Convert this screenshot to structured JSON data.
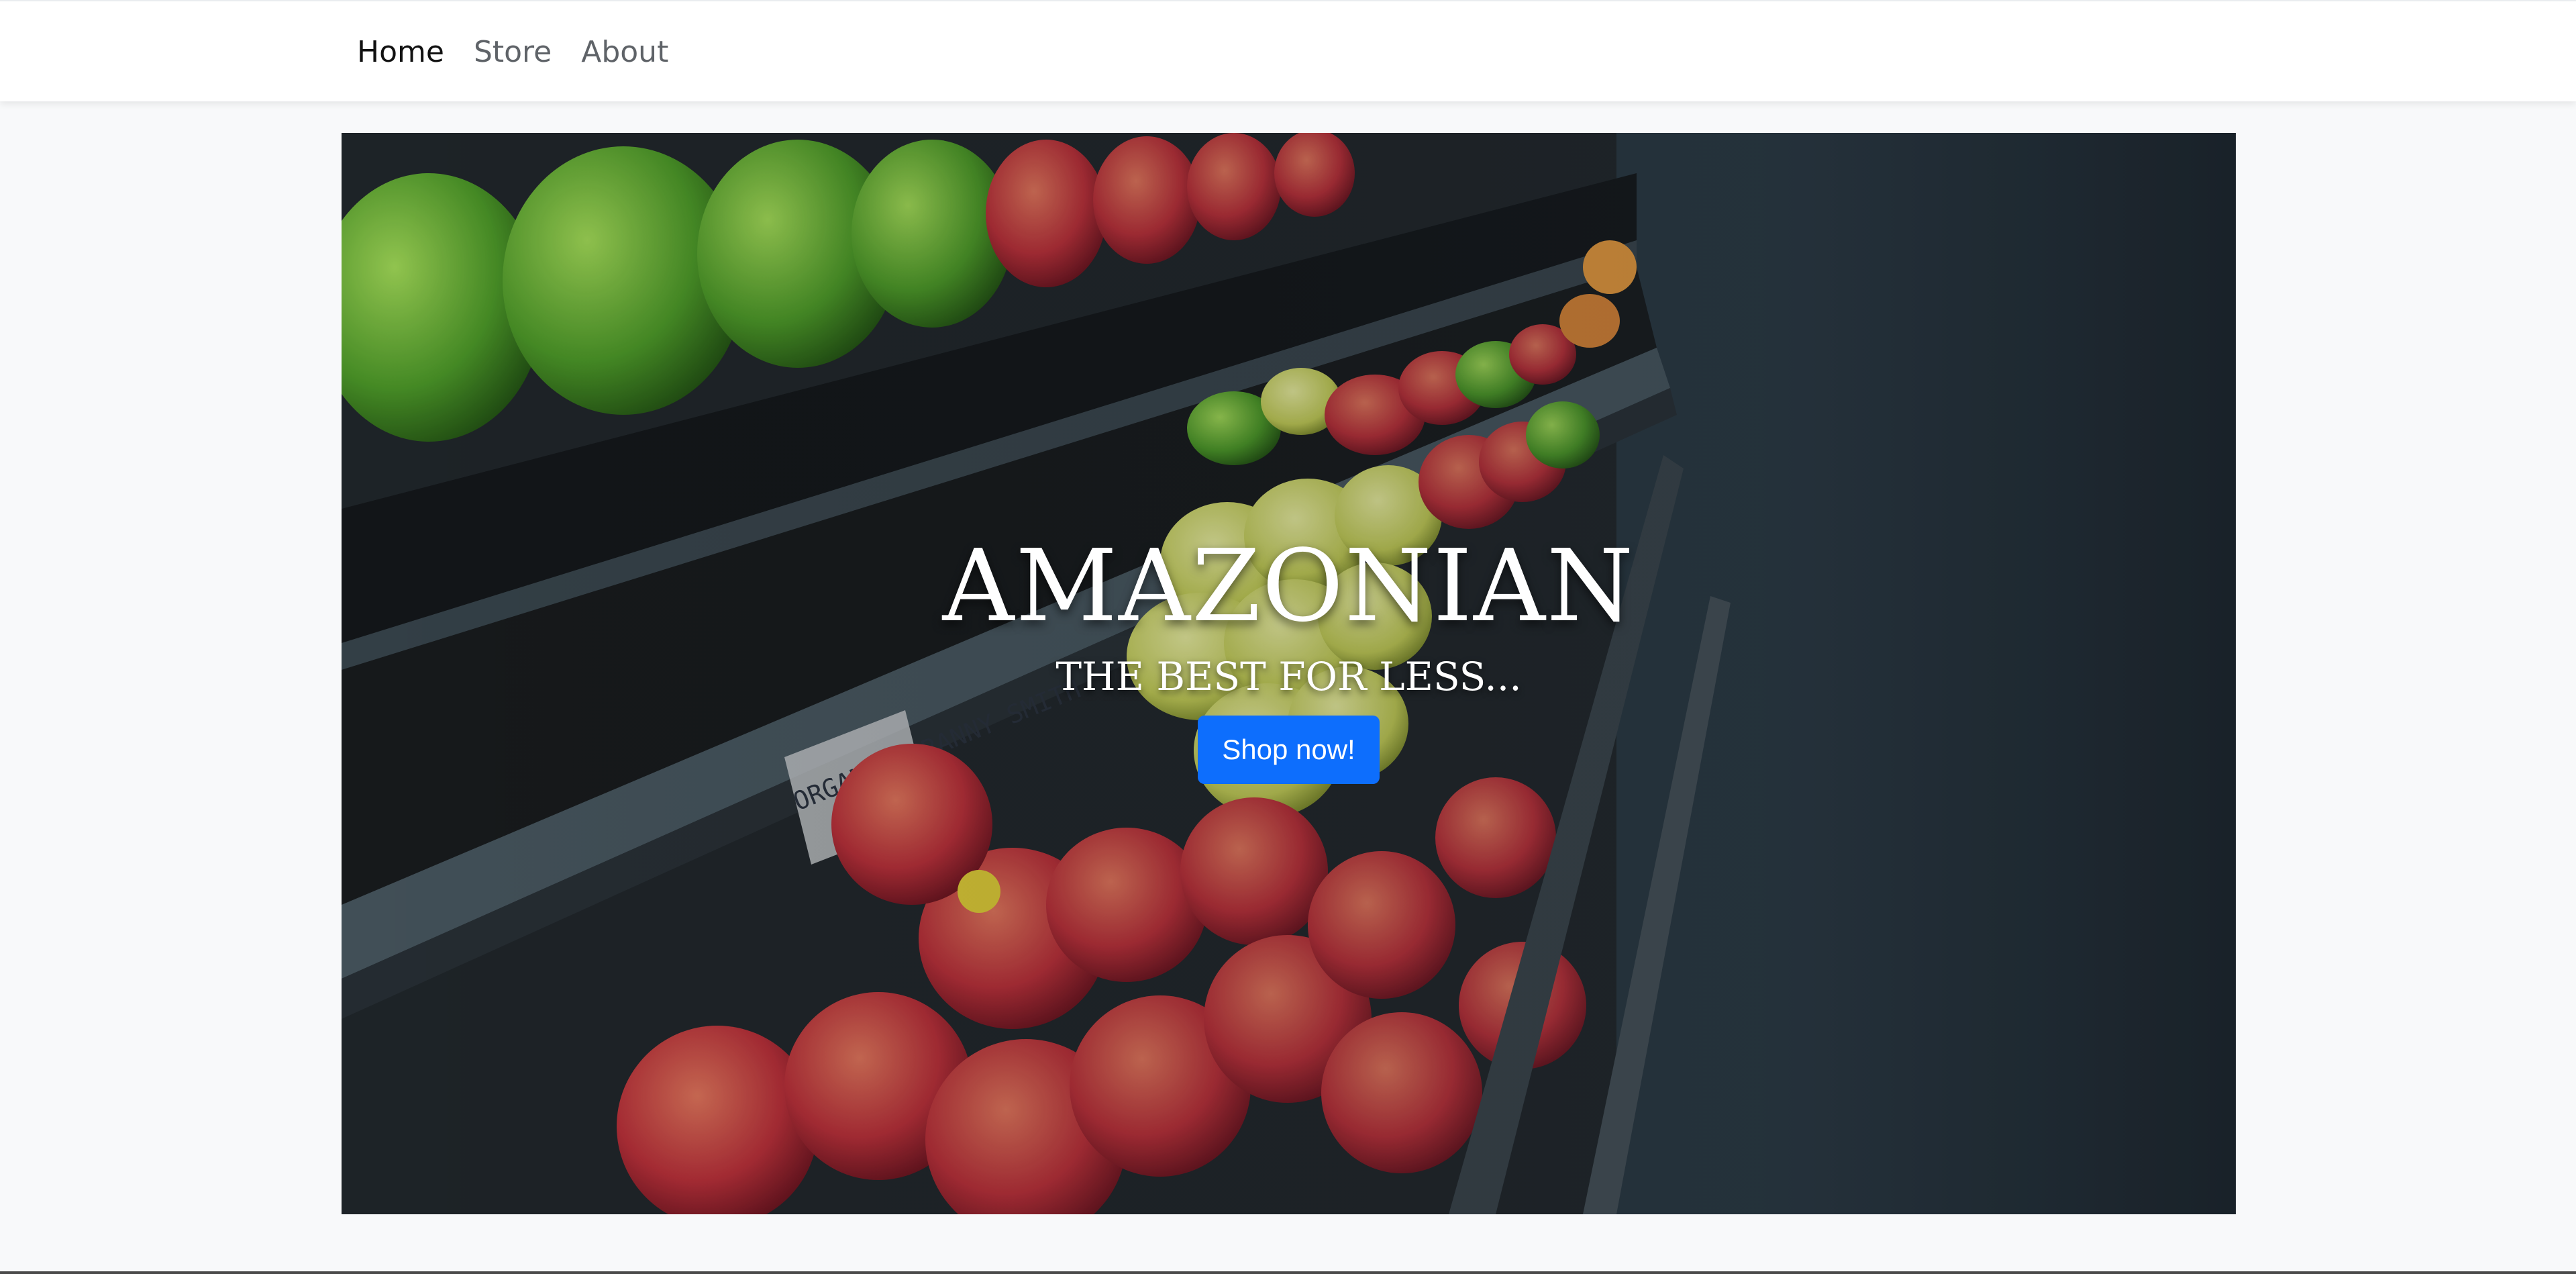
{
  "nav": {
    "items": [
      {
        "label": "Home",
        "active": true
      },
      {
        "label": "Store",
        "active": false
      },
      {
        "label": "About",
        "active": false
      }
    ]
  },
  "hero": {
    "title": "AMAZONIAN",
    "tagline": "THE BEST FOR LESS...",
    "button_label": "Shop now!",
    "image_description": "produce-shelves-photo"
  },
  "colors": {
    "primary": "#0d6efd",
    "page_bg": "#f8f9fa",
    "navbar_bg": "#ffffff",
    "nav_link": "#5f6368",
    "nav_link_active": "#111111"
  }
}
